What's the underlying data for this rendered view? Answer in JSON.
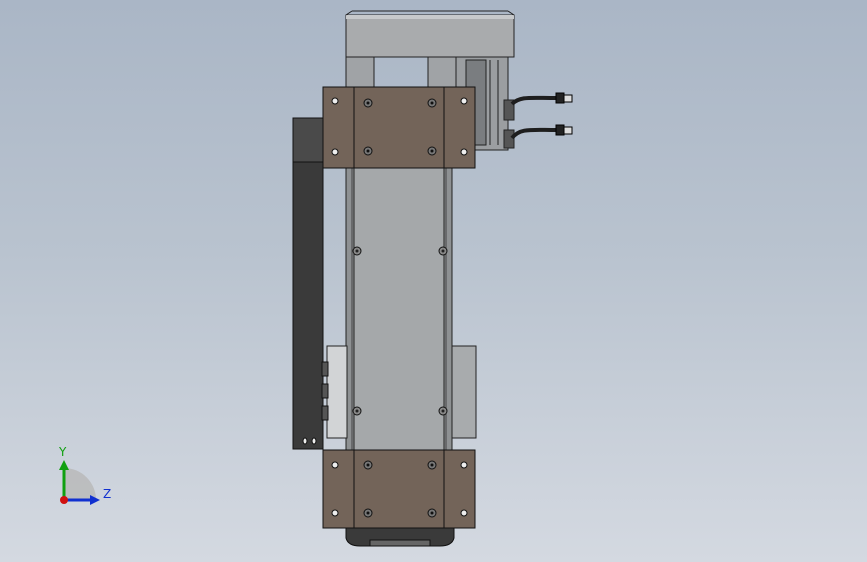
{
  "viewport": {
    "background_top": "#aab6c6",
    "background_bottom": "#d4d9e1"
  },
  "model": {
    "plate_color": "#736459",
    "rail_color": "#a7aaac",
    "motor_color": "#9ea1a4",
    "dark_color": "#3b3b3b",
    "cable_color": "#1e1e1e"
  },
  "triad": {
    "y_label": "Y",
    "z_label": "Z",
    "x_color": "#d01010",
    "y_color": "#10a010",
    "z_color": "#1030d0"
  }
}
